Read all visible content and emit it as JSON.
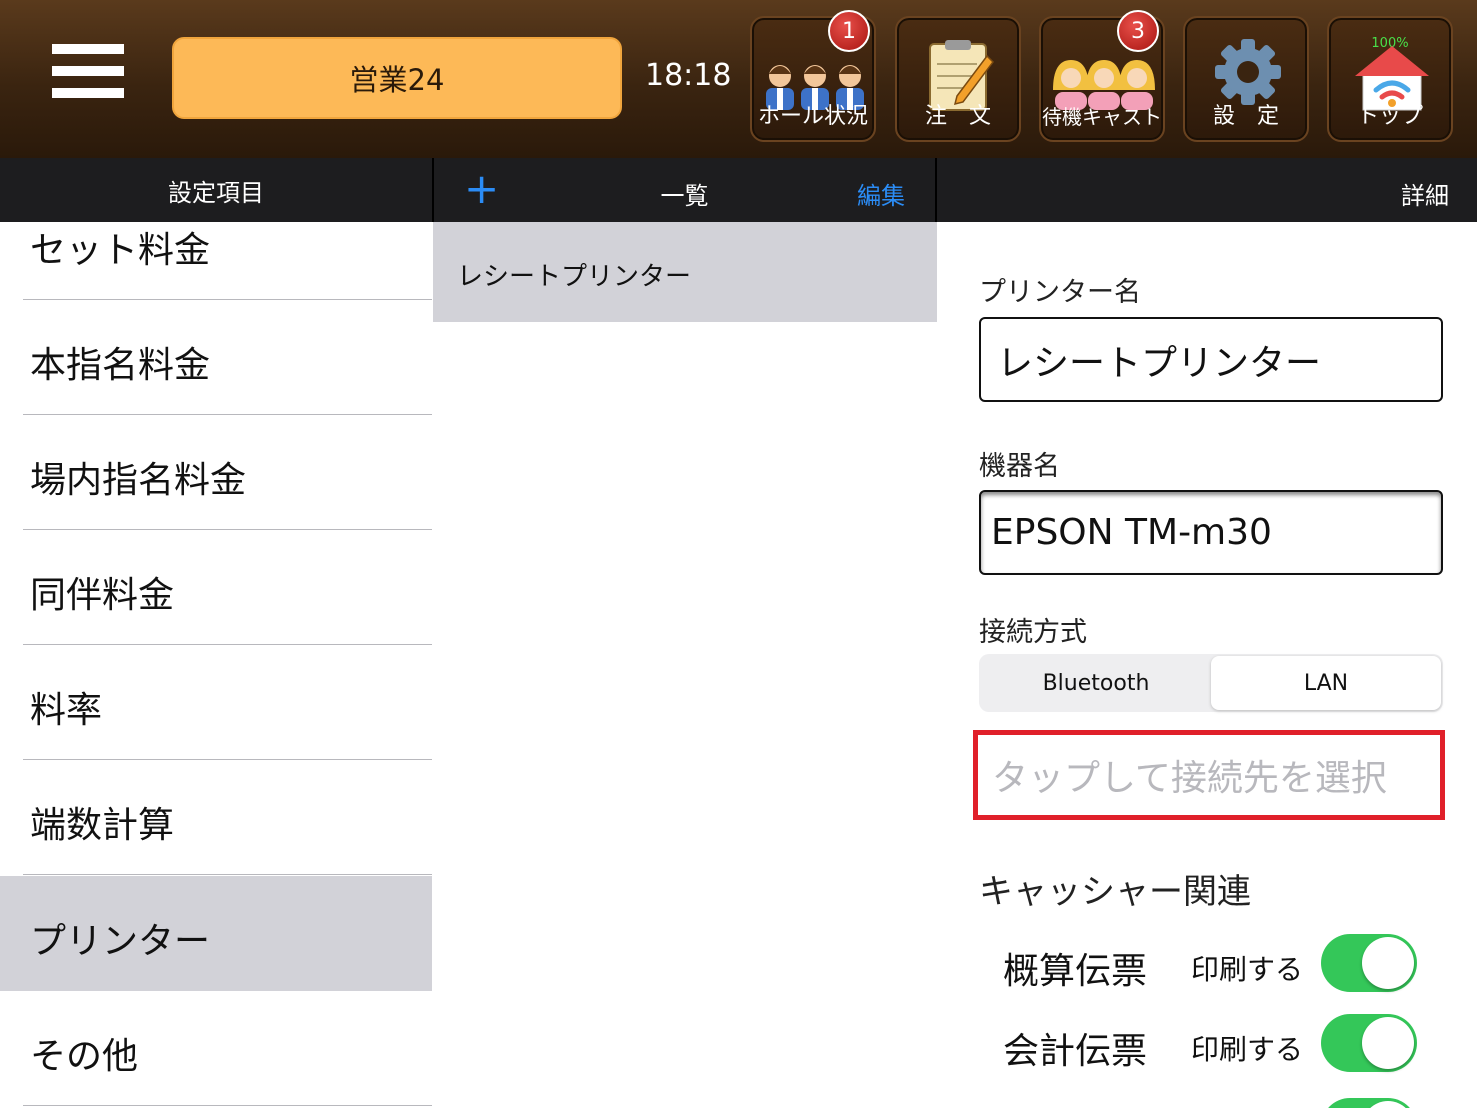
{
  "topbar": {
    "business_label": "営業24",
    "time": "18:18",
    "buttons": [
      {
        "label": "ホール状況",
        "badge": "1",
        "icon": "hall-status-icon"
      },
      {
        "label": "注　文",
        "icon": "order-clipboard-icon"
      },
      {
        "label": "待機キャスト",
        "badge": "3",
        "icon": "waiting-cast-icon"
      },
      {
        "label": "設　定",
        "icon": "gear-icon"
      },
      {
        "label": "トップ",
        "percent": "100%",
        "icon": "home-wifi-icon"
      }
    ]
  },
  "columns": {
    "left_title": "設定項目",
    "middle_title": "一覧",
    "add": "+",
    "edit": "編集",
    "right_title": "詳細"
  },
  "settings_items": [
    "セット料金",
    "本指名料金",
    "場内指名料金",
    "同伴料金",
    "料率",
    "端数計算",
    "プリンター",
    "その他"
  ],
  "list": {
    "items": [
      "レシートプリンター"
    ]
  },
  "detail": {
    "printer_name_label": "プリンター名",
    "printer_name": "レシートプリンター",
    "device_name_label": "機器名",
    "device_name": "EPSON TM-m30",
    "connection_label": "接続方式",
    "connection_options": [
      "Bluetooth",
      "LAN"
    ],
    "connection_selected": "LAN",
    "connection_target_placeholder": "タップして接続先を選択",
    "cashier_section": "キャッシャー関連",
    "toggles": [
      {
        "name": "概算伝票",
        "state": "印刷する"
      },
      {
        "name": "会計伝票",
        "state": "印刷する"
      }
    ]
  },
  "colors": {
    "accent_blue": "#2b8cf5",
    "toggle_on": "#34c759",
    "highlight_red": "#e0202a",
    "business_button": "#fdb957"
  }
}
